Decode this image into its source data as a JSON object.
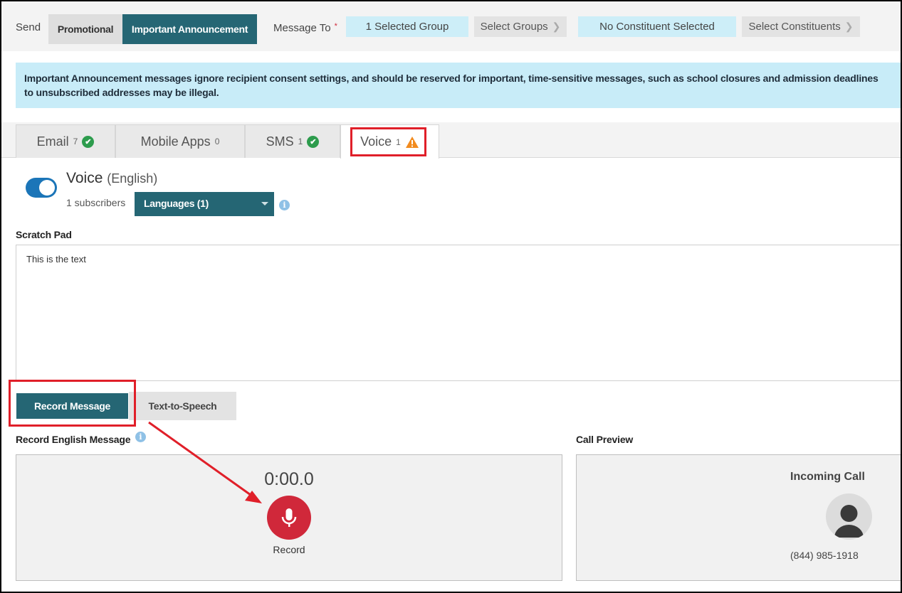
{
  "header": {
    "send_label": "Send",
    "send_options": [
      "Promotional",
      "Important Announcement"
    ],
    "selected_send_option": "Important Announcement",
    "message_to_label": "Message To",
    "required_marker": "*",
    "groups_status": "1 Selected Group",
    "select_groups_label": "Select Groups",
    "constituents_status": "No Constituent Selected",
    "select_constituents_label": "Select Constituents"
  },
  "notice": {
    "line1": "Important Announcement messages ignore recipient consent settings, and should be reserved for important, time-sensitive messages, such as school closures and admission deadlines",
    "line2": "to unsubscribed addresses may be illegal."
  },
  "tabs": [
    {
      "label": "Email",
      "count": "7",
      "status": "ok"
    },
    {
      "label": "Mobile Apps",
      "count": "0",
      "status": "none"
    },
    {
      "label": "SMS",
      "count": "1",
      "status": "ok"
    },
    {
      "label": "Voice",
      "count": "1",
      "status": "warning"
    }
  ],
  "active_tab": "Voice",
  "voice": {
    "enabled": true,
    "title": "Voice",
    "language": "(English)",
    "subscribers": "1 subscribers",
    "languages_dropdown": "Languages (1)",
    "scratch_pad_label": "Scratch Pad",
    "scratch_pad_text": "This is the text",
    "mode_buttons": [
      "Record Message",
      "Text-to-Speech"
    ],
    "selected_mode": "Record Message",
    "record_section_label": "Record English Message",
    "timer": "0:00.0",
    "record_label": "Record",
    "preview_label": "Call Preview",
    "incoming_call_label": "Incoming Call",
    "phone_number": "(844) 985-1918"
  },
  "colors": {
    "primary": "#256674",
    "notice_bg": "#c8ecf8",
    "record_red": "#d0283a",
    "success_green": "#2d9c4d",
    "warning_orange": "#f28b1e",
    "annotation_red": "#e01f29",
    "toggle_blue": "#1b75b8"
  }
}
